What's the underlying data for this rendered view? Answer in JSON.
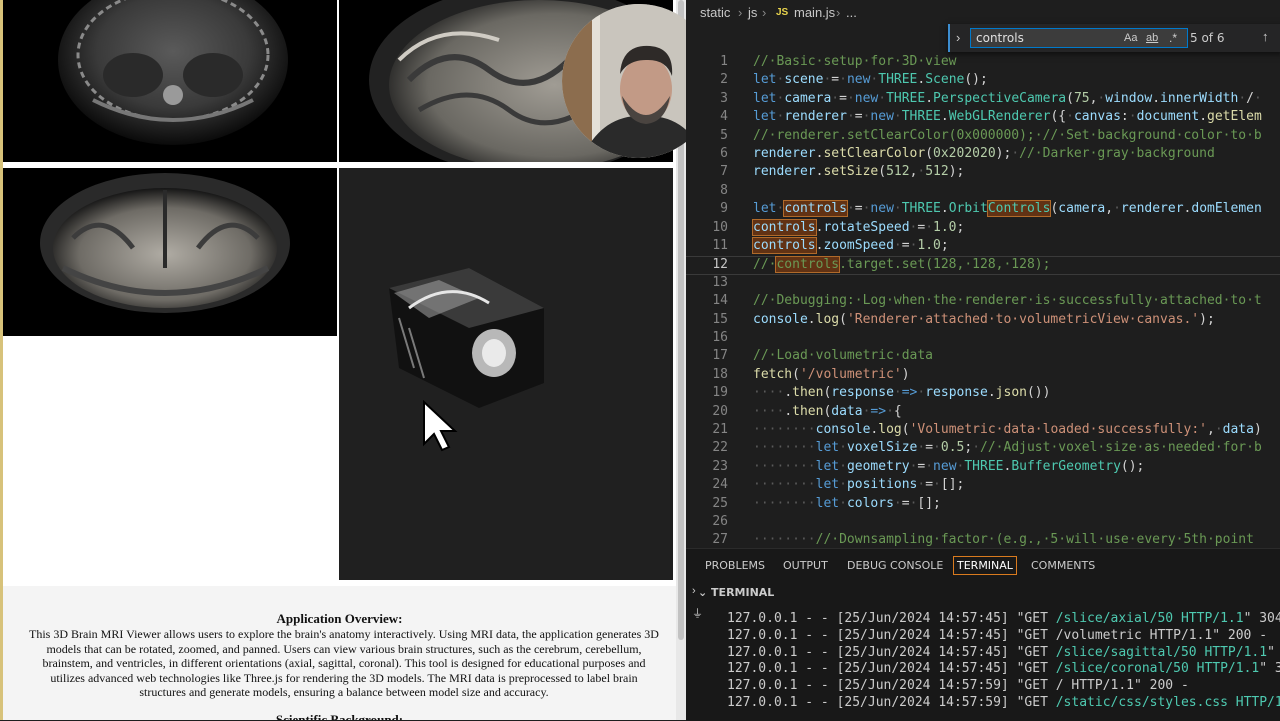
{
  "browser": {
    "overview_title": "Application Overview:",
    "overview_text": "This 3D Brain MRI Viewer allows users to explore the brain's anatomy interactively. Using MRI data, the application generates 3D models that can be rotated, zoomed, and panned. Users can view various brain structures, such as the cerebrum, cerebellum, brainstem, and ventricles, in different orientations (axial, sagittal, coronal). This tool is designed for educational purposes and utilizes advanced web technologies like Three.js for rendering the 3D models. The MRI data is preprocessed to label brain structures and generate models, ensuring a balance between model size and accuracy.",
    "background_title": "Scientific Background:"
  },
  "editor": {
    "breadcrumb": [
      "static",
      "js",
      "main.js",
      "..."
    ],
    "find": {
      "query": "controls",
      "match_case": "Aa",
      "whole_word": "ab",
      "regex": ".*",
      "count": "5 of 6"
    },
    "active_line": 12
  },
  "panel": {
    "tabs": [
      "PROBLEMS",
      "OUTPUT",
      "DEBUG CONSOLE",
      "TERMINAL",
      "COMMENTS"
    ],
    "active_tab": "TERMINAL",
    "terminal_title": "TERMINAL",
    "lines": [
      {
        "prefix": "127.0.0.1 - - [25/Jun/2024 14:57:45] \"GET ",
        "path": "/slice/axial/50 HTTP/1.1",
        "suffix": "\" 304"
      },
      {
        "prefix": "127.0.0.1 - - [25/Jun/2024 14:57:45] \"GET /volumetric HTTP/1.1\" 200 -",
        "path": "",
        "suffix": ""
      },
      {
        "prefix": "127.0.0.1 - - [25/Jun/2024 14:57:45] \"GET ",
        "path": "/slice/sagittal/50 HTTP/1.1",
        "suffix": "\" 3"
      },
      {
        "prefix": "127.0.0.1 - - [25/Jun/2024 14:57:45] \"GET ",
        "path": "/slice/coronal/50 HTTP/1.1",
        "suffix": "\" 30"
      },
      {
        "prefix": "127.0.0.1 - - [25/Jun/2024 14:57:59] \"GET / HTTP/1.1\" 200 -",
        "path": "",
        "suffix": ""
      },
      {
        "prefix": "127.0.0.1 - - [25/Jun/2024 14:57:59] \"GET ",
        "path": "/static/css/styles.css HTTP/1",
        "suffix": ""
      }
    ]
  },
  "icons": {
    "cursor": "mouse-pointer-icon",
    "find_toggle": "chevron-right-icon",
    "find_prev": "arrow-up-icon"
  },
  "colors": {
    "editor_bg": "#1e1e1e",
    "find_highlight": "#613214",
    "terminal_tab_border": "#d97a1e"
  }
}
